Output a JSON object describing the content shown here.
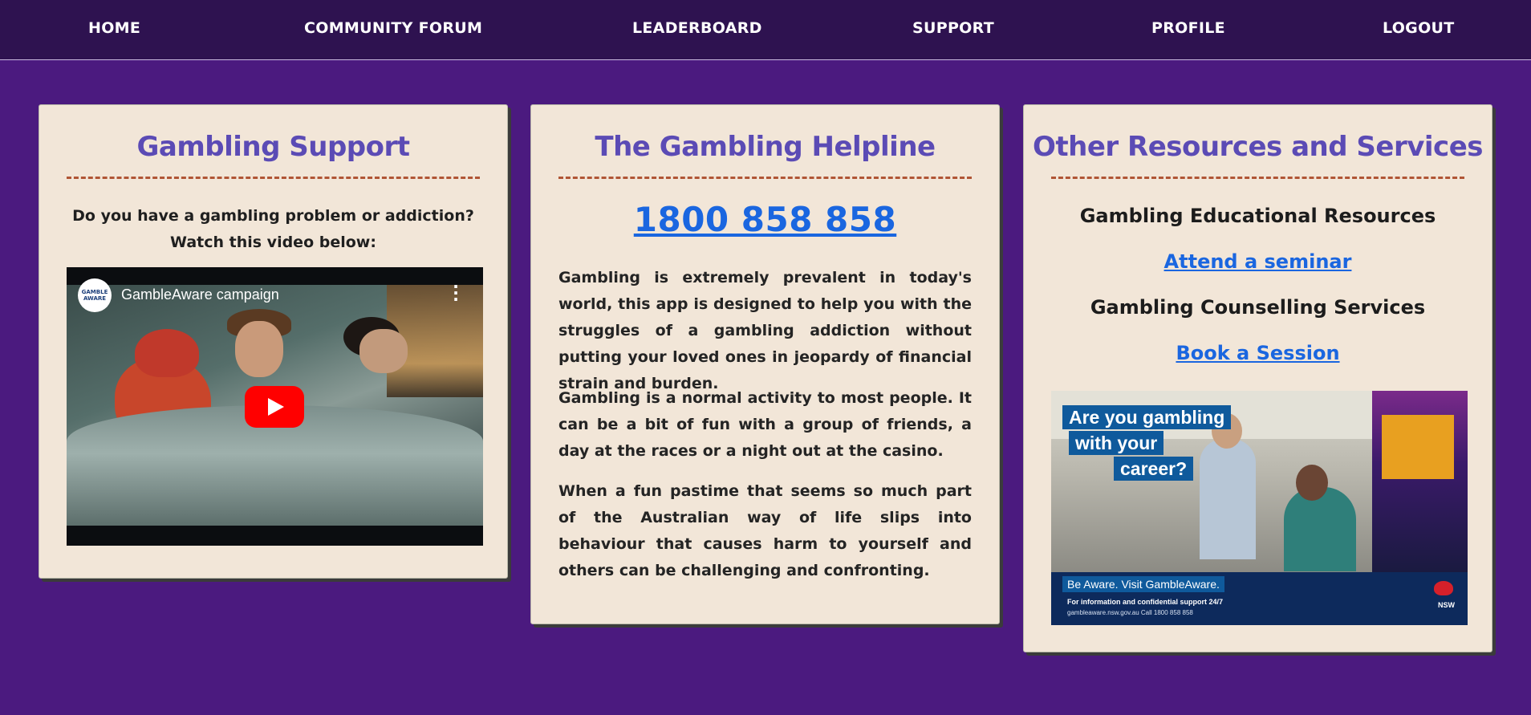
{
  "nav": {
    "items": [
      {
        "label": "HOME"
      },
      {
        "label": "COMMUNITY FORUM"
      },
      {
        "label": "LEADERBOARD"
      },
      {
        "label": "SUPPORT"
      },
      {
        "label": "PROFILE"
      },
      {
        "label": "LOGOUT"
      }
    ]
  },
  "support_card": {
    "title": "Gambling Support",
    "intro_line1": "Do you have a gambling problem or addiction?",
    "intro_line2": "Watch this video below:",
    "video": {
      "channel_logo_text": "GAMBLE AWARE",
      "title": "GambleAware campaign",
      "menu_icon": "more-vert-icon",
      "play_icon": "youtube-play-icon"
    }
  },
  "helpline_card": {
    "title": "The Gambling Helpline",
    "phone": "1800 858 858",
    "paragraphs": [
      "Gambling is extremely prevalent in today's world, this app is designed to help you with the struggles of a gambling addiction without putting your loved ones in jeopardy of financial strain and burden.",
      "Gambling is a normal activity to most people. It can be a bit of fun with a group of friends, a day at the races or a night out at the casino.",
      "When a fun pastime that seems so much part of the Australian way of life slips into behaviour that causes harm to yourself and others can be challenging and confronting."
    ]
  },
  "resources_card": {
    "title": "Other Resources and Services",
    "education_heading": "Gambling Educational Resources",
    "seminar_link": "Attend a seminar",
    "counselling_heading": "Gambling Counselling Services",
    "session_link": "Book a Session",
    "ad": {
      "headline_1": "Are you gambling",
      "headline_2": "with your",
      "headline_3": "career?",
      "be_aware": "Be Aware. Visit GambleAware.",
      "info": "For information and confidential support 24/7",
      "contact": "gambleaware.nsw.gov.au      Call 1800 858 858",
      "brand": "NSW"
    }
  },
  "colors": {
    "background": "#4b1a7f",
    "nav": "#2e1250",
    "card": "#f2e6d8",
    "title": "#5b4bb5",
    "link": "#1a66e0",
    "rule": "#b05535"
  }
}
